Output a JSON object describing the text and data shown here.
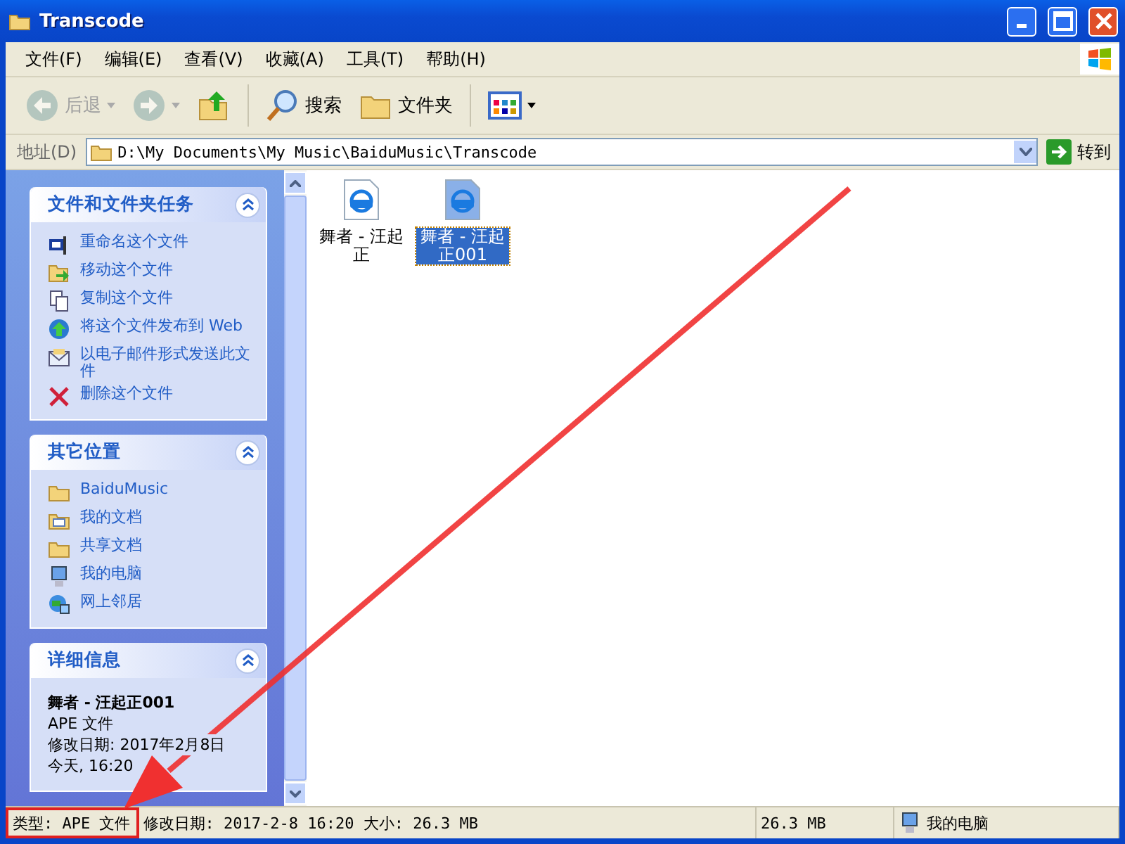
{
  "window": {
    "title": "Transcode"
  },
  "menu": [
    "文件(F)",
    "编辑(E)",
    "查看(V)",
    "收藏(A)",
    "工具(T)",
    "帮助(H)"
  ],
  "toolbar": [
    {
      "kind": "back",
      "label": "后退",
      "disabled": true
    },
    {
      "kind": "forward",
      "disabled": true
    },
    {
      "kind": "up",
      "disabled": false
    },
    {
      "kind": "search",
      "label": "搜索",
      "disabled": false
    },
    {
      "kind": "folders",
      "label": "文件夹",
      "disabled": false
    },
    {
      "kind": "views",
      "disabled": false
    }
  ],
  "address": {
    "label": "地址(D)",
    "value": "D:\\My Documents\\My Music\\BaiduMusic\\Transcode",
    "go": "转到"
  },
  "panels": [
    {
      "kind": "list",
      "title": "文件和文件夹任务",
      "items": [
        {
          "kind": "rename",
          "label": "重命名这个文件"
        },
        {
          "kind": "move",
          "label": "移动这个文件"
        },
        {
          "kind": "copy",
          "label": "复制这个文件"
        },
        {
          "kind": "publish",
          "label": "将这个文件发布到 Web"
        },
        {
          "kind": "email",
          "label": "以电子邮件形式发送此文件"
        },
        {
          "kind": "delete",
          "label": "删除这个文件"
        }
      ]
    },
    {
      "kind": "list",
      "title": "其它位置",
      "items": [
        {
          "kind": "folder",
          "label": "BaiduMusic"
        },
        {
          "kind": "documents",
          "label": "我的文档"
        },
        {
          "kind": "folder",
          "label": "共享文档"
        },
        {
          "kind": "computer",
          "label": "我的电脑"
        },
        {
          "kind": "network",
          "label": "网上邻居"
        }
      ]
    },
    {
      "kind": "details",
      "title": "详细信息",
      "name": "舞者 - 汪起正001",
      "lines": [
        "APE 文件",
        "修改日期: 2017年2月8日",
        "今天, 16:20"
      ]
    }
  ],
  "files": [
    {
      "name": "舞者 - 汪起正",
      "selected": false
    },
    {
      "name": "舞者 - 汪起正001",
      "selected": true
    }
  ],
  "status": [
    {
      "text": "类型: APE 文件",
      "highlighted": true
    },
    {
      "text": "修改日期: 2017-2-8 16:20 大小: 26.3 MB",
      "highlighted": false
    },
    {
      "text": "26.3 MB",
      "highlighted": false
    },
    {
      "text": "我的电脑",
      "highlighted": false,
      "kind": "computer"
    }
  ],
  "annotations": [
    {
      "kind": "arrow"
    }
  ]
}
